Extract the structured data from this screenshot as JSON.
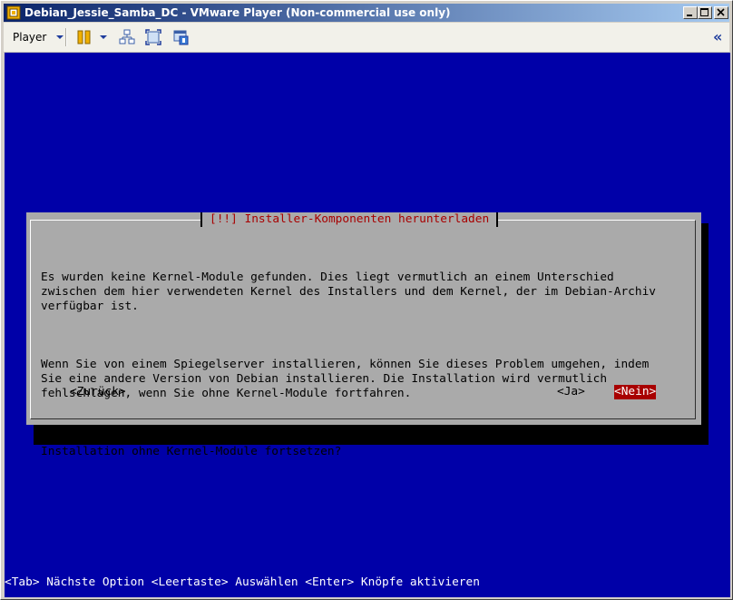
{
  "window": {
    "title": "Debian_Jessie_Samba_DC - VMware Player (Non-commercial use only)"
  },
  "toolbar": {
    "player_label": "Player",
    "icons": [
      "pause-icon",
      "send-ctrl-alt-del-icon",
      "fullscreen-icon",
      "unity-icon"
    ],
    "collapse_label": "«"
  },
  "dialog": {
    "title": "[!!] Installer-Komponenten herunterladen",
    "paragraphs": [
      "Es wurden keine Kernel-Module gefunden. Dies liegt vermutlich an einem Unterschied\nzwischen dem hier verwendeten Kernel des Installers und dem Kernel, der im Debian-Archiv\nverfügbar ist.",
      "Wenn Sie von einem Spiegelserver installieren, können Sie dieses Problem umgehen, indem\nSie eine andere Version von Debian installieren. Die Installation wird vermutlich\nfehlschlagen, wenn Sie ohne Kernel-Module fortfahren.",
      "Installation ohne Kernel-Module fortsetzen?"
    ],
    "buttons": {
      "back": "<Zurück>",
      "yes": "<Ja>",
      "no": "<Nein>"
    },
    "selected_button": "no"
  },
  "status_line": "<Tab> Nächste Option <Leertaste> Auswählen <Enter> Knöpfe aktivieren",
  "colors": {
    "console_bg": "#0000a8",
    "dialog_bg": "#aaaaaa",
    "title_red": "#a80000",
    "selected_bg": "#a80000"
  }
}
